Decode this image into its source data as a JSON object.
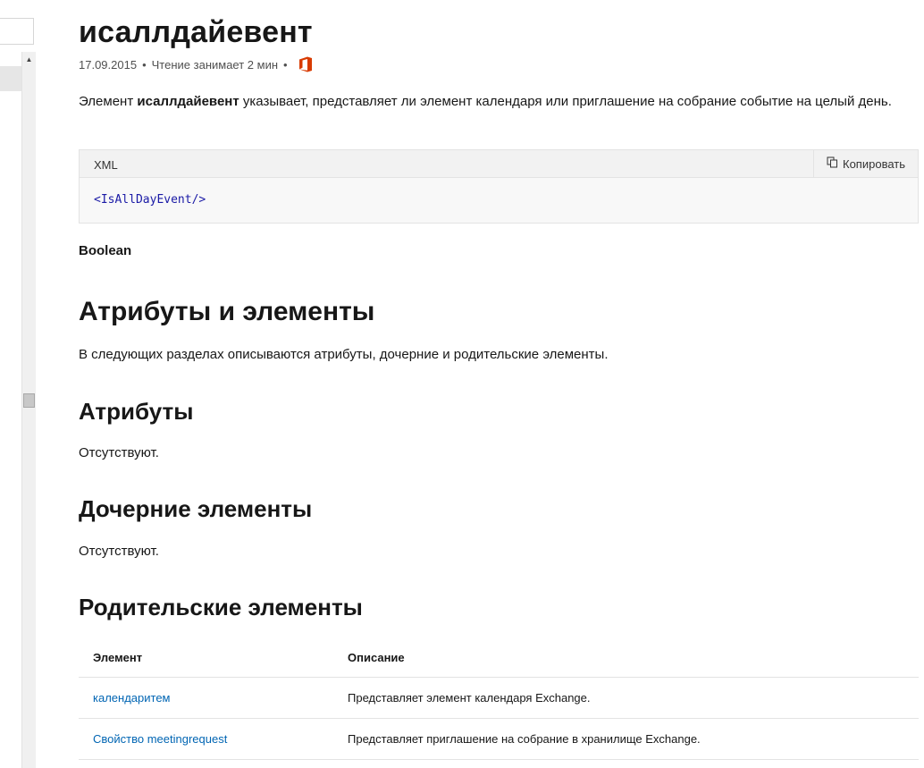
{
  "page": {
    "title": "исаллдайевент",
    "meta": {
      "date": "17.09.2015",
      "separator": "•",
      "read_time": "Чтение занимает 2 мин",
      "product_icon": "office-icon",
      "product_color": "#d83b01"
    },
    "lead_prefix": "Элемент ",
    "lead_bold": "исаллдайевент",
    "lead_rest": " указывает, представляет ли элемент календаря или приглашение на собрание событие на целый день."
  },
  "code": {
    "language": "XML",
    "copy_label": "Копировать",
    "copy_icon": "copy-icon",
    "snippet": "<IsAllDayEvent/>"
  },
  "type_label": "Boolean",
  "sections": {
    "attrs_and_elements": {
      "heading": "Атрибуты и элементы",
      "text": "В следующих разделах описываются атрибуты, дочерние и родительские элементы."
    },
    "attributes": {
      "heading": "Атрибуты",
      "text": "Отсутствуют."
    },
    "child_elements": {
      "heading": "Дочерние элементы",
      "text": "Отсутствуют."
    },
    "parent_elements": {
      "heading": "Родительские элементы",
      "columns": [
        "Элемент",
        "Описание"
      ],
      "rows": [
        {
          "element": "календаритем",
          "description": "Представляет элемент календаря Exchange."
        },
        {
          "element": "Свойство meetingrequest",
          "description": "Представляет приглашение на собрание в хранилище Exchange."
        }
      ]
    }
  },
  "colors": {
    "link": "#0065b3",
    "code": "#1a1aa6",
    "text": "#171717"
  }
}
